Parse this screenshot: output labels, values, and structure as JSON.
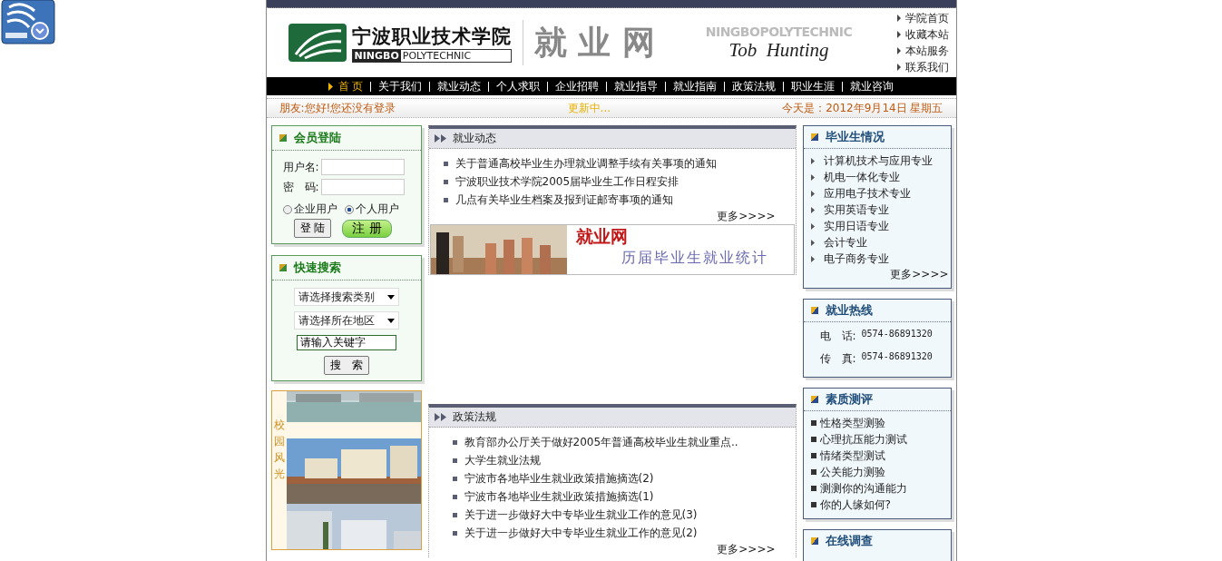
{
  "header": {
    "school_name": "宁波职业技术学院",
    "school_name_en_bold": "NINGBO",
    "school_name_en": "POLYTECHNIC",
    "site_title": "就 业 网",
    "faded_title": "NINGBOPOLYTECHNIC",
    "slogan": "Tob  Hunting",
    "links": [
      "学院首页",
      "收藏本站",
      "本站服务",
      "联系我们"
    ]
  },
  "nav": [
    {
      "label": "首 页",
      "selected": true
    },
    {
      "label": "关于我们",
      "selected": false
    },
    {
      "label": "就业动态",
      "selected": false
    },
    {
      "label": "个人求职",
      "selected": false
    },
    {
      "label": "企业招聘",
      "selected": false
    },
    {
      "label": "就业指导",
      "selected": false
    },
    {
      "label": "就业指南",
      "selected": false
    },
    {
      "label": "政策法规",
      "selected": false
    },
    {
      "label": "职业生涯",
      "selected": false
    },
    {
      "label": "就业咨询",
      "selected": false
    }
  ],
  "status_bar": {
    "greeting": "朋友:您好!您还没有登录",
    "ticker": "更新中...",
    "date": "今天是：2012年9月14日 星期五"
  },
  "login": {
    "title": "会员登陆",
    "username_label": "用户名:",
    "password_label": "密　码:",
    "user_types": [
      {
        "label": "企业用户",
        "selected": false
      },
      {
        "label": "个人用户",
        "selected": true
      }
    ],
    "login_button": "登 陆",
    "register_button": "注 册"
  },
  "quick_search": {
    "title": "快速搜索",
    "category": "请选择搜索类别",
    "region": "请选择所在地区",
    "keyword": "请输入关键字",
    "search_button": "搜　索"
  },
  "campus": {
    "title": "校园风光"
  },
  "news": {
    "title": "就业动态",
    "items": [
      "关于普通高校毕业生办理就业调整手续有关事项的通知",
      "宁波职业技术学院2005届毕业生工作日程安排",
      "几点有关毕业生档案及报到证邮寄事项的通知"
    ],
    "more": "更多>>>>",
    "banner_title": "就业网",
    "banner_subtitle": "历届毕业生就业统计"
  },
  "policy": {
    "title": "政策法规",
    "items": [
      "教育部办公厅关于做好2005年普通高校毕业生就业重点..",
      "大学生就业法规",
      "宁波市各地毕业生就业政策措施摘选(2)",
      "宁波市各地毕业生就业政策措施摘选(1)",
      "关于进一步做好大中专毕业生就业工作的意见(3)",
      "关于进一步做好大中专毕业生就业工作的意见(2)"
    ],
    "more": "更多>>>>"
  },
  "graduates": {
    "title": "毕业生情况",
    "items": [
      "计算机技术与应用专业",
      "机电一体化专业",
      "应用电子技术专业",
      "实用英语专业",
      "实用日语专业",
      "会计专业",
      "电子商务专业"
    ],
    "more": "更多>>>>"
  },
  "hotline": {
    "title": "就业热线",
    "rows": [
      {
        "label": "电　话:",
        "value": "0574-86891320"
      },
      {
        "label": "传　真:",
        "value": "0574-86891320"
      }
    ]
  },
  "assessment": {
    "title": "素质测评",
    "items": [
      "性格类型测验",
      "心理抗压能力测试",
      "情绪类型测试",
      "公关能力测验",
      "测测你的沟通能力",
      "你的人缘如何?"
    ]
  },
  "survey": {
    "title": "在线调查"
  }
}
